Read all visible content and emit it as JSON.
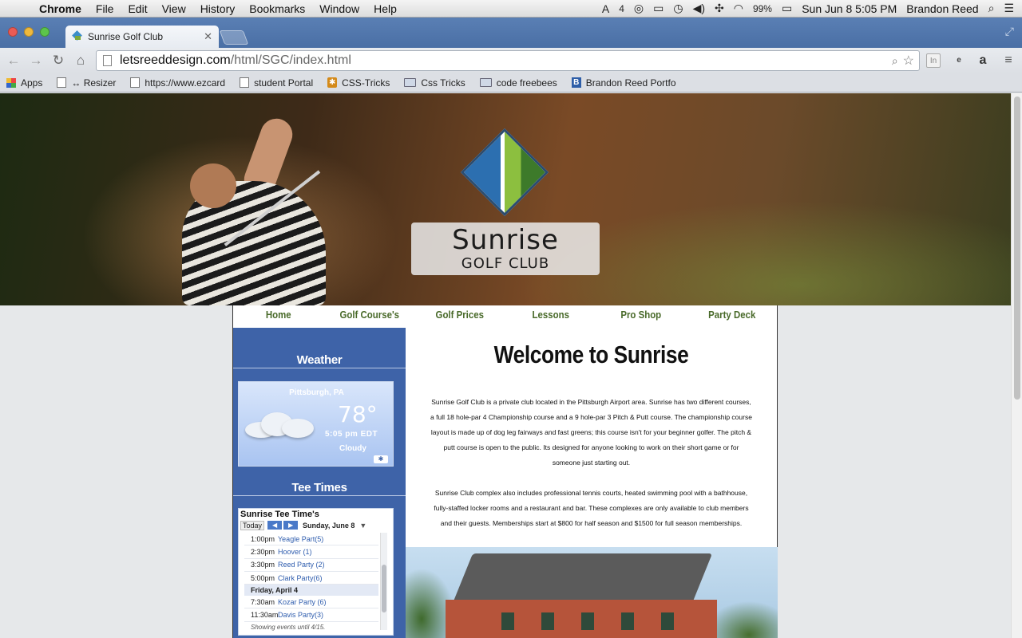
{
  "menubar": {
    "app": "Chrome",
    "menus": [
      "File",
      "Edit",
      "View",
      "History",
      "Bookmarks",
      "Window",
      "Help"
    ],
    "status": {
      "adobe_badge": "4",
      "battery": "99%",
      "datetime": "Sun Jun 8  5:05 PM",
      "user": "Brandon Reed"
    }
  },
  "browser": {
    "tab_title": "Sunrise Golf Club",
    "url_host": "letsreeddesign.com",
    "url_path": "/html/SGC/index.html",
    "bookmarks": [
      "Apps",
      "↔ Resizer",
      "https://www.ezcard",
      "student Portal",
      "CSS-Tricks",
      "Css Tricks",
      "code freebees",
      "Brandon Reed Portfo"
    ]
  },
  "site": {
    "logo_name": "Sunrise",
    "logo_sub": "GOLF CLUB",
    "nav": [
      "Home",
      "Golf Course's",
      "Golf Prices",
      "Lessons",
      "Pro Shop",
      "Party Deck"
    ],
    "sidebar": {
      "weather_title": "Weather",
      "weather": {
        "city": "Pittsburgh, PA",
        "temp": "78°",
        "time": "5:05 pm EDT",
        "condition": "Cloudy"
      },
      "tee_title": "Tee Times",
      "calendar": {
        "title": "Sunrise Tee Time's",
        "today": "Today",
        "date_label": "Sunday, June 8",
        "events": [
          {
            "time": "1:00pm",
            "name": "Yeagle Part(5)"
          },
          {
            "time": "2:30pm",
            "name": "Hoover (1)"
          },
          {
            "time": "3:30pm",
            "name": "Reed Party (2)"
          },
          {
            "time": "5:00pm",
            "name": "Clark Party(6)"
          }
        ],
        "day_header": "Friday, April 4",
        "events2": [
          {
            "time": "7:30am",
            "name": "Kozar Party (6)"
          },
          {
            "time": "11:30am",
            "name": "Davis Party(3)"
          }
        ],
        "footer": "Showing events until 4/15."
      }
    },
    "main": {
      "heading": "Welcome to Sunrise",
      "p1": "Sunrise Golf Club is a private club located in the Pittsburgh Airport area. Sunrise has two different courses, a full 18 hole-par 4 Championship course and a 9 hole-par 3 Pitch & Putt course. The championship course layout is made up of dog leg fairways and fast greens; this course isn't for your beginner golfer. The pitch & putt course is open to the public. Its designed for anyone looking to work on their short game or for someone just starting out.",
      "p2": "Sunrise Club complex also includes professional tennis courts, heated swimming pool with a bathhouse, fully-staffed locker rooms and a restaurant and bar. These complexes are only available to club members and their guests. Memberships start at $800 for half season and $1500 for full season memberships."
    }
  }
}
